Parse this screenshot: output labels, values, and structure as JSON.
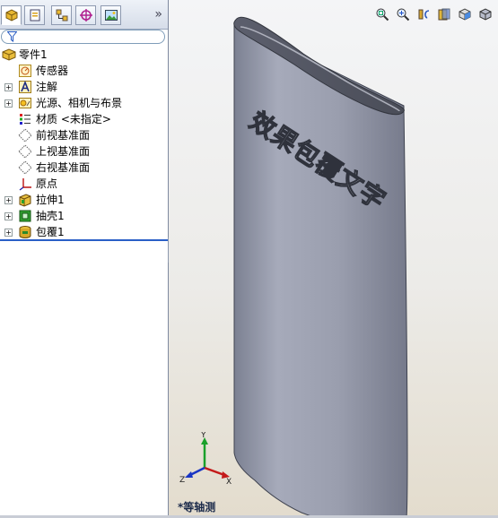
{
  "feature_tree": {
    "root": "零件1",
    "items": [
      {
        "label": "传感器",
        "icon": "sensor-icon",
        "expandable": false
      },
      {
        "label": "注解",
        "icon": "annotation-icon",
        "expandable": true
      },
      {
        "label": "光源、相机与布景",
        "icon": "lights-icon",
        "expandable": true
      },
      {
        "label": "材质 <未指定>",
        "icon": "material-icon",
        "expandable": false
      },
      {
        "label": "前视基准面",
        "icon": "plane-icon",
        "expandable": false
      },
      {
        "label": "上视基准面",
        "icon": "plane-icon",
        "expandable": false
      },
      {
        "label": "右视基准面",
        "icon": "plane-icon",
        "expandable": false
      },
      {
        "label": "原点",
        "icon": "origin-icon",
        "expandable": false
      },
      {
        "label": "拉伸1",
        "icon": "extrude-icon",
        "expandable": true
      },
      {
        "label": "抽壳1",
        "icon": "shell-icon",
        "expandable": true
      },
      {
        "label": "包覆1",
        "icon": "wrap-icon",
        "expandable": true
      }
    ]
  },
  "panel_tabs": [
    "featuremanager-tab-icon",
    "propertymanager-tab-icon",
    "configurationmanager-tab-icon",
    "dimxpert-tab-icon",
    "display-manager-tab-icon"
  ],
  "panel_expand_glyph": "»",
  "model": {
    "embossed_text": "效果包覆文字",
    "body_color": "#9ea2b2"
  },
  "triad": {
    "x": "X",
    "y": "Y",
    "z": "Z"
  },
  "view_name": "*等轴测",
  "view_toolbar": [
    "zoom-to-fit-icon",
    "zoom-area-icon",
    "previous-view-icon",
    "section-view-icon",
    "view-orientation-icon",
    "display-style-icon"
  ]
}
